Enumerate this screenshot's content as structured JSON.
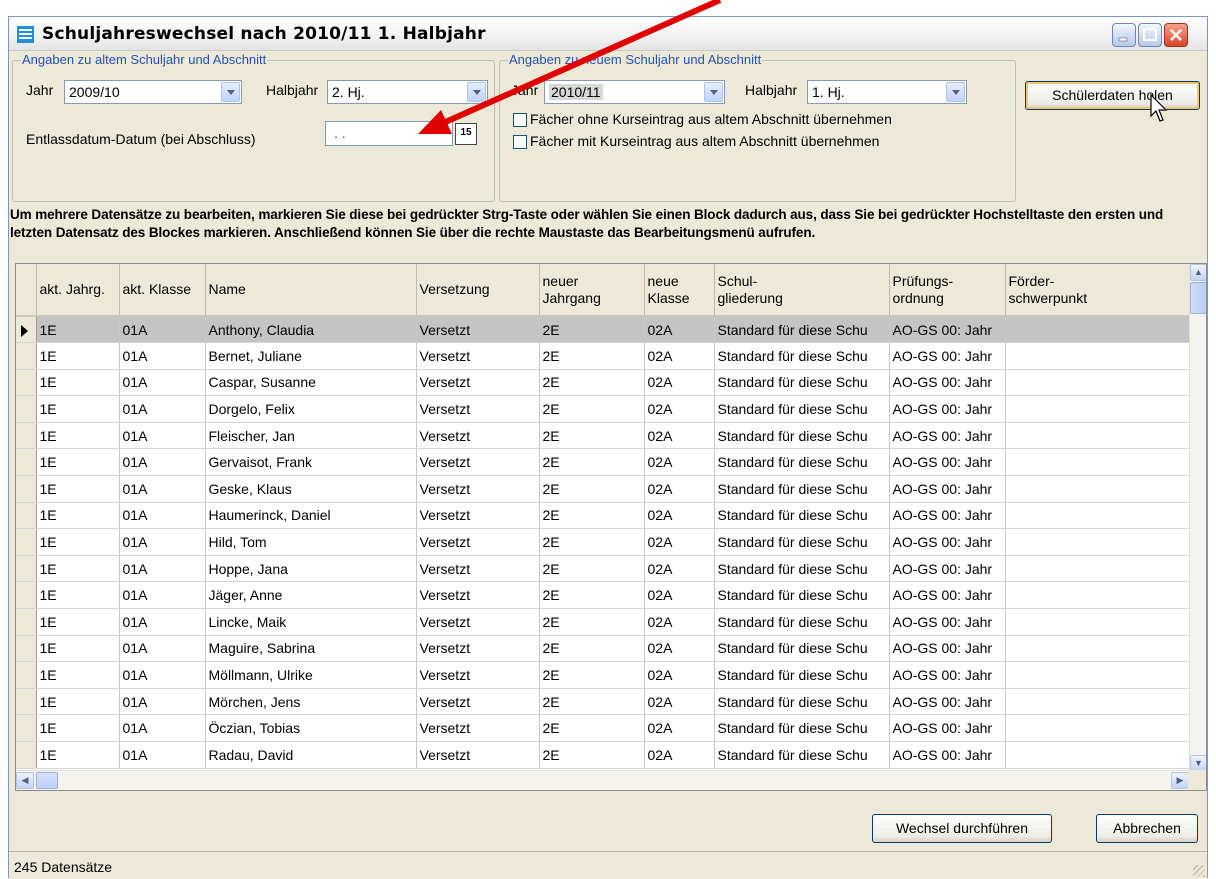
{
  "window": {
    "title": "Schuljahreswechsel nach 2010/11 1. Halbjahr"
  },
  "old_section": {
    "legend": "Angaben zu altem Schuljahr und Abschnitt",
    "jahr_label": "Jahr",
    "jahr_value": "2009/10",
    "halbjahr_label": "Halbjahr",
    "halbjahr_value": "2. Hj.",
    "entlass_label": "Entlassdatum-Datum (bei Abschluss)",
    "entlass_value": ". .",
    "calendar_label": "15"
  },
  "new_section": {
    "legend": "Angaben zu neuem Schuljahr und Abschnitt",
    "jahr_label": "Jahr",
    "jahr_value": "2010/11",
    "halbjahr_label": "Halbjahr",
    "halbjahr_value": "1. Hj.",
    "checkbox1_label": "Fächer ohne Kurseintrag aus altem Abschnitt übernehmen",
    "checkbox2_label": "Fächer mit Kurseintrag aus altem Abschnitt übernehmen"
  },
  "buttons": {
    "fetch": "Schülerdaten holen",
    "execute": "Wechsel durchführen",
    "cancel": "Abbrechen"
  },
  "instructions": "Um mehrere Datensätze zu bearbeiten, markieren Sie diese bei gedrückter Strg-Taste oder wählen Sie einen Block dadurch aus, dass Sie bei gedrückter Hochstelltaste den ersten und letzten Datensatz des Blockes markieren. Anschließend können Sie über die rechte Maustaste das Bearbeitungsmenü aufrufen.",
  "table": {
    "columns": [
      [
        "akt. Jahrg."
      ],
      [
        "akt. Klasse"
      ],
      [
        "Name"
      ],
      [
        "Versetzung"
      ],
      [
        "neuer",
        "Jahrgang"
      ],
      [
        "neue",
        "Klasse"
      ],
      [
        "Schul-",
        "gliederung"
      ],
      [
        "Prüfungs-",
        "ordnung"
      ],
      [
        "Förder-",
        "schwerpunkt"
      ]
    ],
    "rows": [
      [
        "1E",
        "01A",
        "Anthony, Claudia",
        "Versetzt",
        "2E",
        "02A",
        "Standard für diese Schu",
        "AO-GS 00: Jahr",
        ""
      ],
      [
        "1E",
        "01A",
        "Bernet, Juliane",
        "Versetzt",
        "2E",
        "02A",
        "Standard für diese Schu",
        "AO-GS 00: Jahr",
        ""
      ],
      [
        "1E",
        "01A",
        "Caspar, Susanne",
        "Versetzt",
        "2E",
        "02A",
        "Standard für diese Schu",
        "AO-GS 00: Jahr",
        ""
      ],
      [
        "1E",
        "01A",
        "Dorgelo, Felix",
        "Versetzt",
        "2E",
        "02A",
        "Standard für diese Schu",
        "AO-GS 00: Jahr",
        ""
      ],
      [
        "1E",
        "01A",
        "Fleischer, Jan",
        "Versetzt",
        "2E",
        "02A",
        "Standard für diese Schu",
        "AO-GS 00: Jahr",
        ""
      ],
      [
        "1E",
        "01A",
        "Gervaisot, Frank",
        "Versetzt",
        "2E",
        "02A",
        "Standard für diese Schu",
        "AO-GS 00: Jahr",
        ""
      ],
      [
        "1E",
        "01A",
        "Geske, Klaus",
        "Versetzt",
        "2E",
        "02A",
        "Standard für diese Schu",
        "AO-GS 00: Jahr",
        ""
      ],
      [
        "1E",
        "01A",
        "Haumerinck, Daniel",
        "Versetzt",
        "2E",
        "02A",
        "Standard für diese Schu",
        "AO-GS 00: Jahr",
        ""
      ],
      [
        "1E",
        "01A",
        "Hild, Tom",
        "Versetzt",
        "2E",
        "02A",
        "Standard für diese Schu",
        "AO-GS 00: Jahr",
        ""
      ],
      [
        "1E",
        "01A",
        "Hoppe, Jana",
        "Versetzt",
        "2E",
        "02A",
        "Standard für diese Schu",
        "AO-GS 00: Jahr",
        ""
      ],
      [
        "1E",
        "01A",
        "Jäger, Anne",
        "Versetzt",
        "2E",
        "02A",
        "Standard für diese Schu",
        "AO-GS 00: Jahr",
        ""
      ],
      [
        "1E",
        "01A",
        "Lincke, Maik",
        "Versetzt",
        "2E",
        "02A",
        "Standard für diese Schu",
        "AO-GS 00: Jahr",
        ""
      ],
      [
        "1E",
        "01A",
        "Maguire, Sabrina",
        "Versetzt",
        "2E",
        "02A",
        "Standard für diese Schu",
        "AO-GS 00: Jahr",
        ""
      ],
      [
        "1E",
        "01A",
        "Möllmann, Ulrike",
        "Versetzt",
        "2E",
        "02A",
        "Standard für diese Schu",
        "AO-GS 00: Jahr",
        ""
      ],
      [
        "1E",
        "01A",
        "Mörchen, Jens",
        "Versetzt",
        "2E",
        "02A",
        "Standard für diese Schu",
        "AO-GS 00: Jahr",
        ""
      ],
      [
        "1E",
        "01A",
        "Öczian, Tobias",
        "Versetzt",
        "2E",
        "02A",
        "Standard für diese Schu",
        "AO-GS 00: Jahr",
        ""
      ],
      [
        "1E",
        "01A",
        "Radau, David",
        "Versetzt",
        "2E",
        "02A",
        "Standard für diese Schu",
        "AO-GS 00: Jahr",
        ""
      ]
    ],
    "selected_row": 0
  },
  "status": {
    "text": "245 Datensätze"
  },
  "colors": {
    "annotation_arrow": "#e00000",
    "legend_text": "#2451b8",
    "selected_row": "#c4c4c4"
  },
  "icons": [
    "app-icon",
    "minimize-icon",
    "maximize-icon",
    "close-icon",
    "calendar-icon",
    "chevron-down-icon",
    "row-pointer-icon",
    "scroll-up-icon",
    "scroll-down-icon",
    "scroll-left-icon",
    "scroll-right-icon",
    "mouse-cursor-icon",
    "red-annotation-arrow"
  ]
}
